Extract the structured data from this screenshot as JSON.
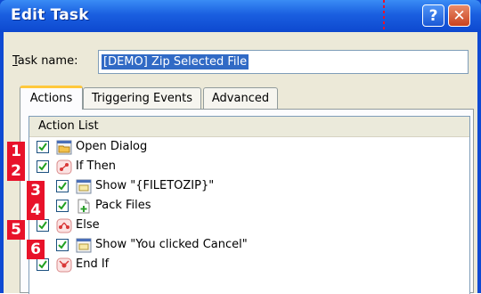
{
  "window": {
    "title": "Edit Task",
    "help_glyph": "?",
    "close_glyph": "✕"
  },
  "task_name": {
    "label_accel": "T",
    "label_rest": "ask name:",
    "value": "[DEMO] Zip Selected File"
  },
  "tabs": [
    {
      "label": "Actions",
      "active": true
    },
    {
      "label": "Triggering Events",
      "active": false
    },
    {
      "label": "Advanced",
      "active": false
    }
  ],
  "action_list": {
    "header": "Action List",
    "rows": [
      {
        "badge": "1",
        "checked": true,
        "icon": "folder-open-icon",
        "text": "Open Dialog"
      },
      {
        "badge": "2",
        "checked": true,
        "icon": "if-branch-icon",
        "text": "If Then"
      },
      {
        "badge": "3",
        "checked": true,
        "icon": "message-window-icon",
        "text": "Show \"{FILETOZIP}\""
      },
      {
        "badge": "4",
        "checked": true,
        "icon": "pack-files-icon",
        "text": "Pack Files"
      },
      {
        "badge": "5",
        "checked": true,
        "icon": "else-branch-icon",
        "text": "Else"
      },
      {
        "badge": "6",
        "checked": true,
        "icon": "message-window-icon",
        "text": "Show \"You clicked Cancel\""
      },
      {
        "badge": "",
        "checked": true,
        "icon": "end-if-icon",
        "text": "End If"
      }
    ]
  },
  "colors": {
    "title_bar": "#1a5fe0",
    "selection": "#316ac5",
    "callout_badge": "#e8122a",
    "active_tab_highlight": "#ffc83c"
  }
}
